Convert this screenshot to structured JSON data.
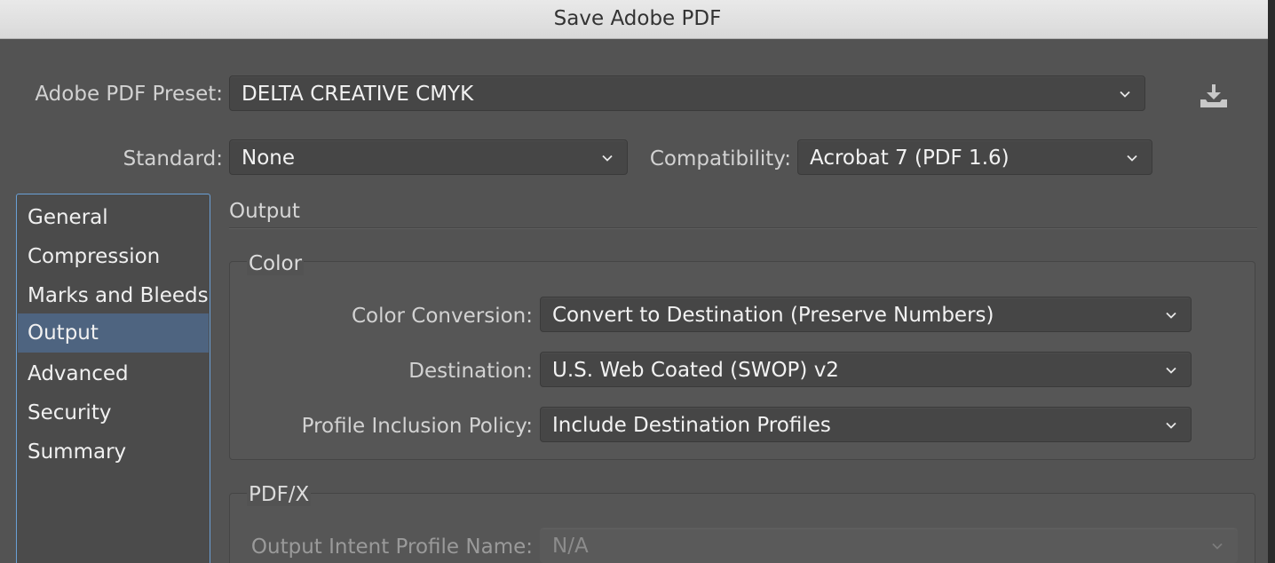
{
  "window": {
    "title": "Save Adobe PDF"
  },
  "preset": {
    "label": "Adobe PDF Preset:",
    "value": "DELTA CREATIVE CMYK"
  },
  "standard": {
    "label": "Standard:",
    "value": "None"
  },
  "compatibility": {
    "label": "Compatibility:",
    "value": "Acrobat 7 (PDF 1.6)"
  },
  "sidebar": {
    "items": [
      {
        "label": "General"
      },
      {
        "label": "Compression"
      },
      {
        "label": "Marks and Bleeds"
      },
      {
        "label": "Output",
        "selected": true
      },
      {
        "label": "Advanced"
      },
      {
        "label": "Security"
      },
      {
        "label": "Summary"
      }
    ]
  },
  "panel": {
    "heading": "Output",
    "color_group": {
      "title": "Color",
      "color_conversion": {
        "label": "Color Conversion:",
        "value": "Convert to Destination (Preserve Numbers)"
      },
      "destination": {
        "label": "Destination:",
        "value": "U.S. Web Coated (SWOP) v2"
      },
      "profile_policy": {
        "label": "Profile Inclusion Policy:",
        "value": "Include Destination Profiles"
      }
    },
    "pdfx_group": {
      "title": "PDF/X",
      "output_intent": {
        "label": "Output Intent Profile Name:",
        "value": "N/A",
        "enabled": false
      }
    }
  },
  "icons": {
    "save_preset": "download-tray-icon",
    "chevron": "chevron-down-icon"
  },
  "colors": {
    "accent": "#6aa0d6",
    "selected_row": "#4e6480",
    "background": "#535353"
  }
}
